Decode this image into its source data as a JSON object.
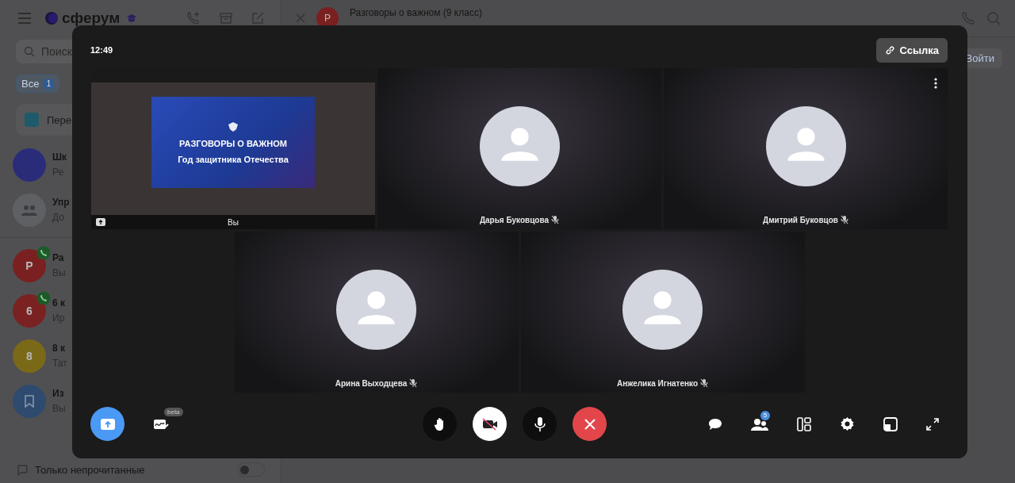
{
  "app": {
    "logo": "сферум",
    "search": {
      "placeholder": "Поиск"
    },
    "filter": {
      "label": "Все",
      "count": "1",
      "selected": true
    },
    "pinned": {
      "title": "Пере"
    },
    "chats": [
      {
        "kind": "image",
        "title": "Шк",
        "subtitle": "Ре",
        "color": "#2a2c7a",
        "in_call": false
      },
      {
        "kind": "group",
        "title": "Упр",
        "subtitle": "До",
        "color": "#5e6063",
        "in_call": false
      },
      {
        "kind": "letter",
        "letter": "Р",
        "title": "Ра",
        "subtitle": "Вы",
        "color": "#7a2020",
        "in_call": true
      },
      {
        "kind": "letter",
        "letter": "6",
        "title": "6 к",
        "subtitle": "Ир",
        "color": "#7a2222",
        "in_call": true
      },
      {
        "kind": "letter",
        "letter": "8",
        "title": "8 к",
        "subtitle": "Тат",
        "color": "#7a6a18",
        "in_call": false
      },
      {
        "kind": "bookmark",
        "title": "Из",
        "subtitle": "Вы",
        "color": "#2e4a6e",
        "in_call": false
      }
    ],
    "unread_toggle": {
      "label": "Только непрочитанные",
      "on": false
    },
    "chat_header": {
      "avatar": "Р",
      "title": "Разговоры о важном (9 класс)"
    },
    "join_button": "Войти"
  },
  "call": {
    "time": "12:49",
    "link_button": "Ссылка",
    "tiles": [
      {
        "kind": "screen",
        "name": "Вы",
        "slide": {
          "title": "РАЗГОВОРЫ О ВАЖНОМ",
          "subtitle": "Год защитника Отечества"
        },
        "menu": false
      },
      {
        "kind": "avatar",
        "name": "Дарья Буковцова",
        "muted": true,
        "menu": false
      },
      {
        "kind": "avatar",
        "name": "Дмитрий Буковцов",
        "muted": true,
        "menu": true
      },
      {
        "kind": "avatar",
        "name": "Арина Выходцева",
        "muted": true,
        "menu": false
      },
      {
        "kind": "avatar",
        "name": "Анжелика Игнатенко",
        "muted": true,
        "menu": false
      }
    ],
    "controls": {
      "whiteboard_badge": "beta",
      "camera_on": false,
      "participants_count": "5"
    }
  }
}
